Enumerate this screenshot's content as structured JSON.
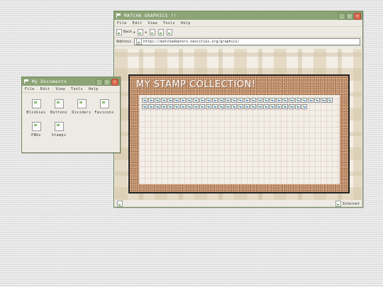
{
  "browser": {
    "title": "MATCHA GRAPHICS !!",
    "menu": [
      "File",
      "Edit",
      "View",
      "Tools",
      "Help"
    ],
    "toolbar": {
      "back_label": "Back"
    },
    "address": {
      "label": "Address",
      "url": "https://matchadopters.neocities.org/graphics/"
    },
    "status": {
      "zone_label": "Internet"
    },
    "page": {
      "board_title": "MY STAMP COLLECTION!",
      "stamp_count": 56
    }
  },
  "docs": {
    "title": "My Documents",
    "menu": [
      "File",
      "Edit",
      "View",
      "Tools",
      "Help"
    ],
    "folders": [
      "Blinkies",
      "Buttons",
      "Dividers",
      "Favicons",
      "PNGs",
      "Stamps"
    ]
  },
  "colors": {
    "titlebar": "#8da477",
    "close_button": "#d96b52",
    "corkboard": "#b98561",
    "desktop": "#e4e4e4"
  }
}
